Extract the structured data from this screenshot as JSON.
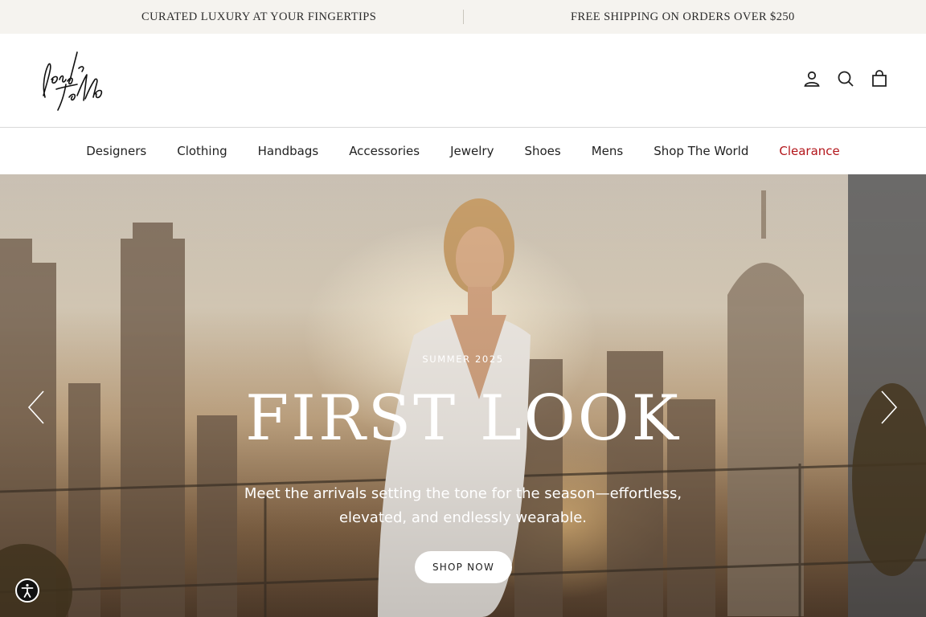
{
  "announcement": {
    "left": "CURATED LUXURY AT YOUR FINGERTIPS",
    "right": "FREE SHIPPING ON ORDERS OVER $250"
  },
  "header": {
    "logo_icon": "lord-and-taylor-signature-logo",
    "icons": [
      "account-icon",
      "search-icon",
      "cart-icon"
    ]
  },
  "nav": {
    "items": [
      {
        "label": "Designers"
      },
      {
        "label": "Clothing"
      },
      {
        "label": "Handbags"
      },
      {
        "label": "Accessories"
      },
      {
        "label": "Jewelry"
      },
      {
        "label": "Shoes"
      },
      {
        "label": "Mens"
      },
      {
        "label": "Shop The World"
      },
      {
        "label": "Clearance"
      }
    ],
    "sale_color": "#b3161b"
  },
  "hero": {
    "eyebrow": "SUMMER 2025",
    "title": "FIRST LOOK",
    "subtitle": "Meet the arrivals setting the tone for the season—effortless, elevated, and endlessly wearable.",
    "cta": "SHOP NOW",
    "prev_icon": "chevron-left-icon",
    "next_icon": "chevron-right-icon"
  },
  "accessibility": {
    "icon": "accessibility-icon"
  }
}
